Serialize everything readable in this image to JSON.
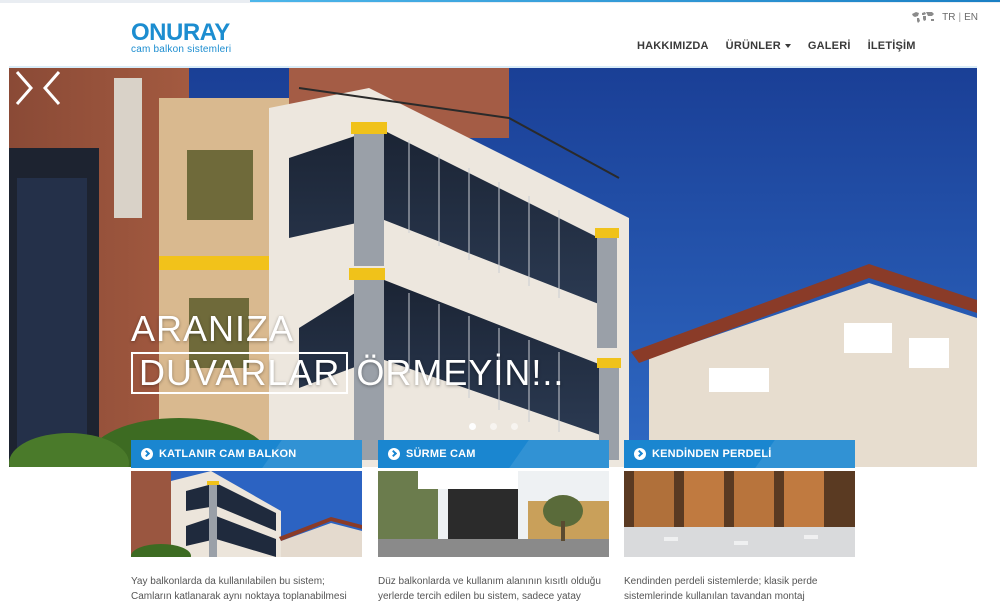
{
  "brand": {
    "name": "ONURAY",
    "tagline": "cam balkon sistemleri"
  },
  "lang": {
    "tr": "TR",
    "sep": "|",
    "en": "EN",
    "map_icon": "world-map-icon"
  },
  "nav": {
    "items": [
      {
        "label": "HAKKIMIZDA"
      },
      {
        "label": "ÜRÜNLER"
      },
      {
        "label": "GALERİ"
      },
      {
        "label": "İLETİŞİM"
      }
    ]
  },
  "hero": {
    "line1": "ARANIZA",
    "boxed": "DUVARLAR",
    "rest": "ÖRMEYİN!..",
    "slides": 3,
    "active_slide": 1,
    "prev_icon": "chevron-left-icon",
    "next_icon": "chevron-right-icon"
  },
  "cards": [
    {
      "title": "KATLANIR CAM BALKON",
      "text": "Yay balkonlarda da kullanılabilen bu sistem; Camların katlanarak aynı noktaya toplanabilmesi özelliği ile tamamen açtığınızda hiç bir bağl..."
    },
    {
      "title": "SÜRME CAM",
      "text": "Düz balkonlarda ve kullanım alanının kısıtlı olduğu yerlerde tercih edilen bu sistem, sadece yatay olarak hareket ederek, balkonlarınızı daha kullanışlı..."
    },
    {
      "title": "KENDİNDEN PERDELİ",
      "text": "Kendinden perdeli sistemlerde; klasik perde sistemlerinde kullanılan tavandan montaj yönteminin aksine, üstten taşımalı sistem kullanılıyor. Perdel..."
    }
  ],
  "colors": {
    "brand_blue": "#1c8dd0",
    "card_header": "#1a86d0",
    "sky": "#1f4aa0"
  }
}
